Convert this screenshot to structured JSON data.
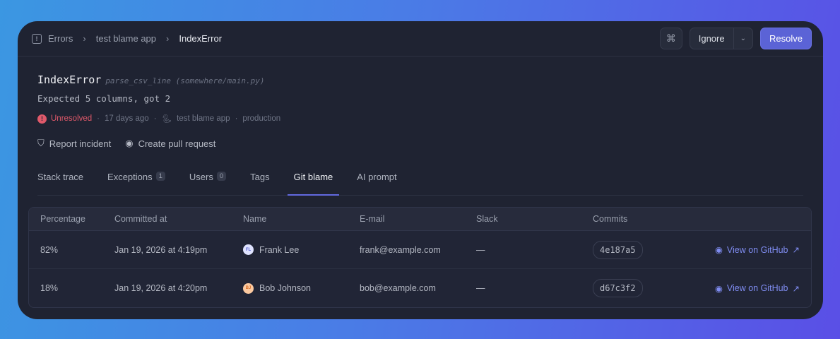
{
  "breadcrumb": {
    "items": [
      "Errors",
      "test blame app",
      "IndexError"
    ]
  },
  "toolbar": {
    "ignore": "Ignore",
    "resolve": "Resolve"
  },
  "error": {
    "type": "IndexError",
    "location": "parse_csv_line (somewhere/main.py)",
    "message": "Expected 5 columns, got 2",
    "status": "Unresolved",
    "age": "17 days ago",
    "app": "test blame app",
    "env": "production"
  },
  "actions": {
    "report": "Report incident",
    "pr": "Create pull request"
  },
  "tabs": [
    {
      "label": "Stack trace"
    },
    {
      "label": "Exceptions",
      "count": "1"
    },
    {
      "label": "Users",
      "count": "0"
    },
    {
      "label": "Tags"
    },
    {
      "label": "Git blame"
    },
    {
      "label": "AI prompt"
    }
  ],
  "table": {
    "headers": [
      "Percentage",
      "Committed at",
      "Name",
      "E-mail",
      "Slack",
      "Commits"
    ],
    "rows": [
      {
        "pct": "82%",
        "at": "Jan 19, 2026 at 4:19pm",
        "initials": "FL",
        "name": "Frank Lee",
        "email": "frank@example.com",
        "slack": "—",
        "commit": "4e187a5",
        "link": "View on GitHub"
      },
      {
        "pct": "18%",
        "at": "Jan 19, 2026 at 4:20pm",
        "initials": "BJ",
        "name": "Bob Johnson",
        "email": "bob@example.com",
        "slack": "—",
        "commit": "d67c3f2",
        "link": "View on GitHub"
      }
    ]
  }
}
